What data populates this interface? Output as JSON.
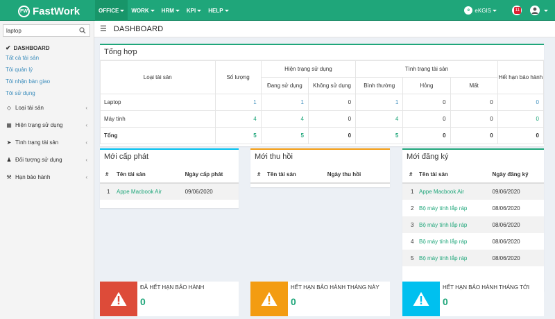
{
  "brand": {
    "logo_text": "FW",
    "name": "FastWork"
  },
  "topnav": [
    "OFFICE",
    "WORK",
    "HRM",
    "KPI",
    "HELP"
  ],
  "topright": {
    "org": "eKGIS",
    "org_logo": "e",
    "notif_badge": "11"
  },
  "search": {
    "value": "laptop"
  },
  "sidebar": {
    "active": "DASHBOARD",
    "subs": [
      "Tất cả tài sản",
      "Tôi quản lý",
      "Tôi nhận bàn giao",
      "Tôi sử dụng"
    ],
    "items": [
      {
        "label": "Loại tài sản",
        "icon": "diamond-icon"
      },
      {
        "label": "Hiện trạng sử dụng",
        "icon": "cubes-icon"
      },
      {
        "label": "Tình trạng tài sản",
        "icon": "send-icon"
      },
      {
        "label": "Đối tượng sử dụng",
        "icon": "user-icon"
      },
      {
        "label": "Hạn bảo hành",
        "icon": "gavel-icon"
      }
    ]
  },
  "header": {
    "title": "DASHBOARD"
  },
  "summary": {
    "title": "Tổng hợp",
    "headers": {
      "asset_type": "Loại tài sản",
      "quantity": "Số lượng",
      "usage_status": "Hiện trạng sử dụng",
      "in_use": "Đang sử dụng",
      "not_in_use": "Không sử dụng",
      "asset_condition": "Tình trạng tài sản",
      "normal": "Bình thường",
      "broken": "Hỏng",
      "lost": "Mất",
      "warranty_expired": "Hết hạn bảo hành"
    },
    "rows": [
      {
        "name": "Laptop",
        "qty": "1",
        "in_use": "1",
        "not_in_use": "0",
        "normal": "1",
        "broken": "0",
        "lost": "0",
        "expired": "0"
      },
      {
        "name": "Máy tính",
        "qty": "4",
        "in_use": "4",
        "not_in_use": "0",
        "normal": "4",
        "broken": "0",
        "lost": "0",
        "expired": "0"
      }
    ],
    "total": {
      "name": "Tổng",
      "qty": "5",
      "in_use": "5",
      "not_in_use": "0",
      "normal": "5",
      "broken": "0",
      "lost": "0",
      "expired": "0"
    }
  },
  "new_issued": {
    "title": "Mới cấp phát",
    "headers": {
      "no": "#",
      "name": "Tên tài sản",
      "date": "Ngày cấp phát"
    },
    "rows": [
      {
        "no": "1",
        "name": "Appe Macbook Air",
        "date": "09/06/2020"
      }
    ]
  },
  "new_recalled": {
    "title": "Mới thu hồi",
    "headers": {
      "no": "#",
      "name": "Tên tài sản",
      "date": "Ngày thu hồi"
    }
  },
  "new_registered": {
    "title": "Mới đăng ký",
    "headers": {
      "no": "#",
      "name": "Tên tài sản",
      "date": "Ngày đăng ký"
    },
    "rows": [
      {
        "no": "1",
        "name": "Appe Macbook Air",
        "date": "09/06/2020"
      },
      {
        "no": "2",
        "name": "Bộ máy tính lắp ráp",
        "date": "08/06/2020"
      },
      {
        "no": "3",
        "name": "Bộ máy tính lắp ráp",
        "date": "08/06/2020"
      },
      {
        "no": "4",
        "name": "Bộ máy tính lắp ráp",
        "date": "08/06/2020"
      },
      {
        "no": "5",
        "name": "Bộ máy tính lắp ráp",
        "date": "08/06/2020"
      }
    ]
  },
  "stats": [
    {
      "label": "ĐÃ HẾT HẠN BẢO HÀNH",
      "value": "0",
      "color": "#dd4b39"
    },
    {
      "label": "HẾT HẠN BẢO HÀNH THÁNG NÀY",
      "value": "0",
      "color": "#f39c12"
    },
    {
      "label": "HẾT HẠN BẢO HÀNH THÁNG TỚI",
      "value": "0",
      "color": "#00c0ef"
    }
  ]
}
